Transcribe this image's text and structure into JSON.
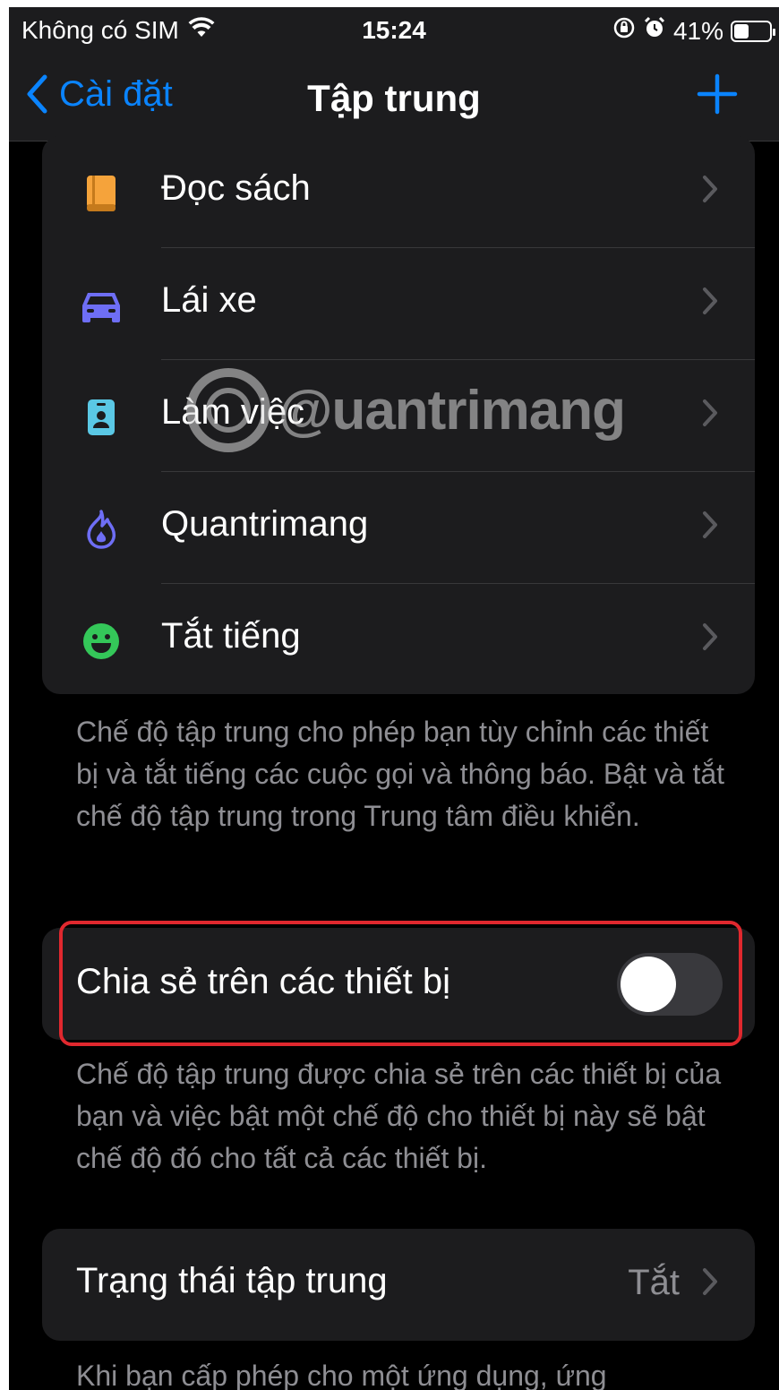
{
  "status_bar": {
    "carrier": "Không có SIM",
    "time": "15:24",
    "battery_percent": "41%",
    "battery_level": 0.41
  },
  "nav": {
    "back_label": "Cài đặt",
    "title": "Tập trung"
  },
  "focus_modes": [
    {
      "label": "Đọc sách",
      "icon": "book-icon",
      "color": "#f5a33b"
    },
    {
      "label": "Lái xe",
      "icon": "car-icon",
      "color": "#6e6ef5"
    },
    {
      "label": "Làm việc",
      "icon": "id-badge-icon",
      "color": "#5ac8e5"
    },
    {
      "label": "Quantrimang",
      "icon": "flame-icon",
      "color": "#6e6ef5"
    },
    {
      "label": "Tắt tiếng",
      "icon": "smiley-icon",
      "color": "#34c759"
    }
  ],
  "focus_note": "Chế độ tập trung cho phép bạn tùy chỉnh các thiết bị và tắt tiếng các cuộc gọi và thông báo. Bật và tắt chế độ tập trung trong Trung tâm điều khiển.",
  "share": {
    "label": "Chia sẻ trên các thiết bị",
    "enabled": false,
    "note": "Chế độ tập trung được chia sẻ trên các thiết bị của bạn và việc bật một chế độ cho thiết bị này sẽ bật chế độ đó cho tất cả các thiết bị."
  },
  "focus_status": {
    "label": "Trạng thái tập trung",
    "value": "Tắt",
    "note": "Khi bạn cấp phép cho một ứng dụng, ứng"
  },
  "watermark": "@uantrimang",
  "colors": {
    "accent": "#0a84ff",
    "highlight": "#e0282e"
  }
}
